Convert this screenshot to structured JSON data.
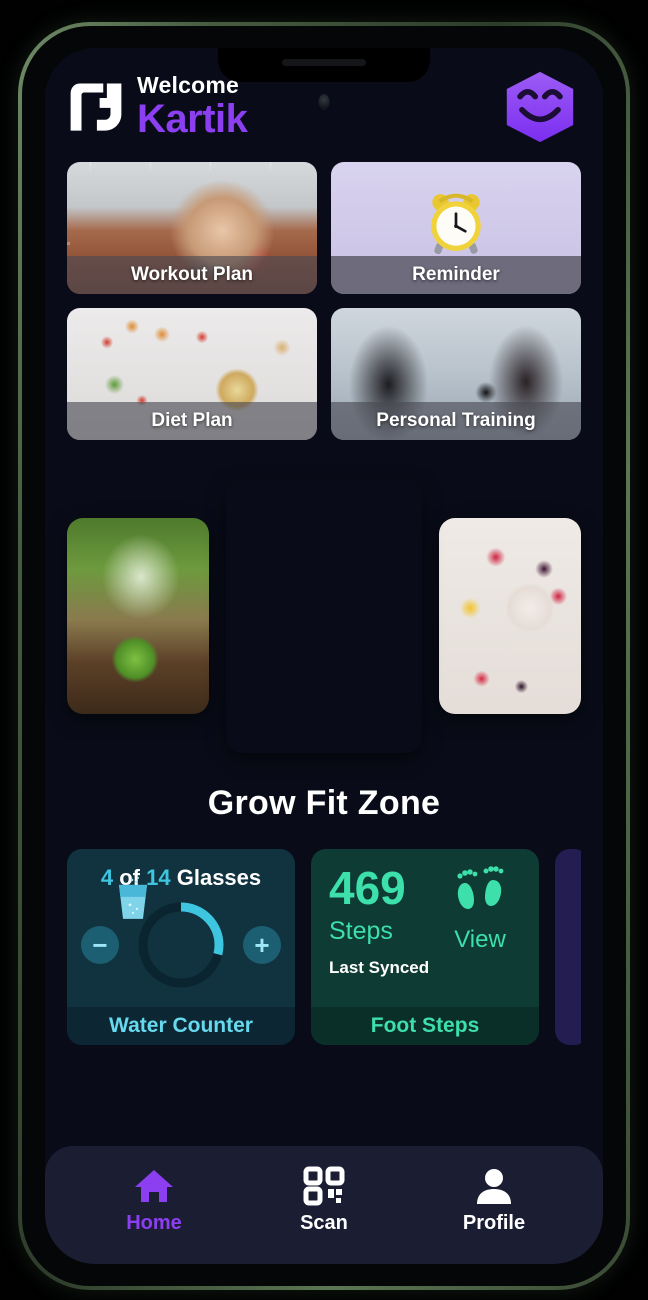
{
  "header": {
    "logo_icon": "gf-monogram-logo",
    "welcome_text": "Welcome",
    "user_name": "Kartik",
    "avatar_icon": "smiley-avatar-icon",
    "name_color": "#8b3ff0"
  },
  "features": [
    {
      "label": "Workout Plan",
      "art": "running-track-photo"
    },
    {
      "label": "Reminder",
      "art": "alarm-clock-photo"
    },
    {
      "label": "Diet Plan",
      "art": "vegetables-salad-photo"
    },
    {
      "label": "Personal Training",
      "art": "dumbbell-training-photo"
    }
  ],
  "carousel": {
    "slides": [
      {
        "position": "left",
        "art": "green-smoothie-apple-photo"
      },
      {
        "position": "center",
        "art": "mixed-nuts-bowl-photo"
      },
      {
        "position": "right",
        "art": "berry-fruit-bowl-photo"
      }
    ]
  },
  "section": {
    "title": "Grow Fit Zone"
  },
  "widgets": {
    "water": {
      "count": "4",
      "separator": "of",
      "goal": "14",
      "unit": "Glasses",
      "decrement_label": "−",
      "increment_label": "+",
      "glass_icon": "water-glass-icon",
      "footer_label": "Water Counter",
      "progress_percent": 29,
      "accent_color": "#3ec6e0"
    },
    "steps": {
      "value": "469",
      "unit": "Steps",
      "sync_label": "Last Synced",
      "view_label": "View",
      "feet_icon": "footprints-icon",
      "footer_label": "Foot Steps",
      "accent_color": "#3ddfab"
    }
  },
  "bottom_nav": {
    "items": [
      {
        "label": "Home",
        "icon": "home-icon",
        "active": true
      },
      {
        "label": "Scan",
        "icon": "qr-scan-icon",
        "active": false
      },
      {
        "label": "Profile",
        "icon": "person-icon",
        "active": false
      }
    ]
  }
}
